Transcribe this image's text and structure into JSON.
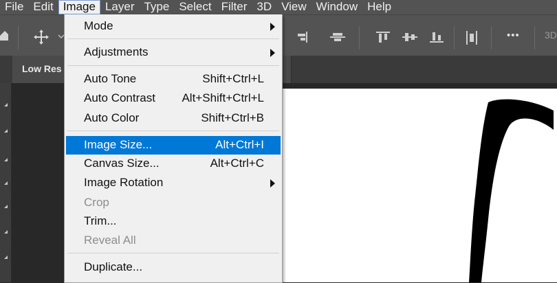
{
  "menubar": {
    "items": [
      "File",
      "Edit",
      "Image",
      "Layer",
      "Type",
      "Select",
      "Filter",
      "3D",
      "View",
      "Window",
      "Help"
    ],
    "active": "Image"
  },
  "toolbar": {
    "icons": [
      "home-icon",
      "move-icon",
      "align-right-icon",
      "align-vertical-center-icon",
      "align-top-icon",
      "distribute-icon",
      "align-bottom-icon",
      "distribute-horizontal-icon",
      "more-options-icon",
      "3d-mode-label"
    ],
    "more_label": "•••",
    "mode_3d_label": "3D"
  },
  "document": {
    "tab_title": "Low Res"
  },
  "image_menu": {
    "mode": {
      "label": "Mode",
      "submenu": true
    },
    "adjustments": {
      "label": "Adjustments",
      "submenu": true
    },
    "auto_tone": {
      "label": "Auto Tone",
      "shortcut": "Shift+Ctrl+L"
    },
    "auto_contrast": {
      "label": "Auto Contrast",
      "shortcut": "Alt+Shift+Ctrl+L"
    },
    "auto_color": {
      "label": "Auto Color",
      "shortcut": "Shift+Ctrl+B"
    },
    "image_size": {
      "label": "Image Size...",
      "shortcut": "Alt+Ctrl+I",
      "highlighted": true
    },
    "canvas_size": {
      "label": "Canvas Size...",
      "shortcut": "Alt+Ctrl+C"
    },
    "image_rotation": {
      "label": "Image Rotation",
      "submenu": true
    },
    "crop": {
      "label": "Crop",
      "disabled": true
    },
    "trim": {
      "label": "Trim..."
    },
    "reveal_all": {
      "label": "Reveal All",
      "disabled": true
    },
    "duplicate": {
      "label": "Duplicate..."
    }
  },
  "colors": {
    "highlight": "#0078d7",
    "menu_bg": "#f0f0f0",
    "chrome": "#535353",
    "workspace": "#282828"
  }
}
